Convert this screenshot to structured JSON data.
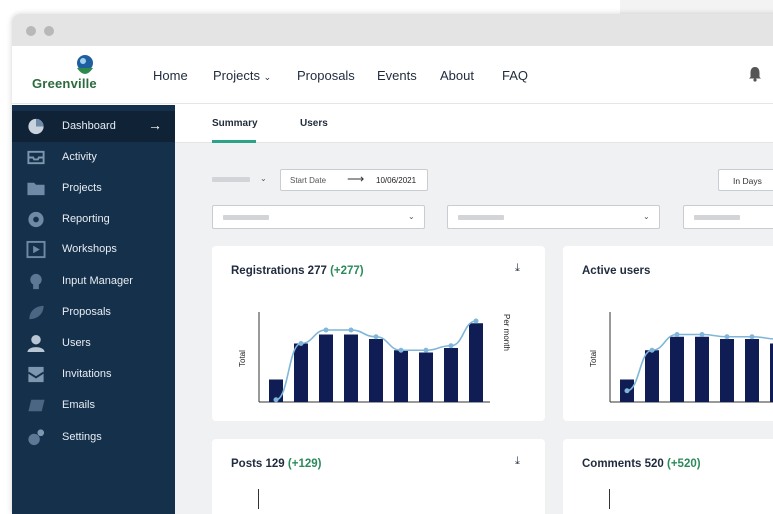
{
  "app": {
    "logo_text": "Greenville"
  },
  "nav": {
    "items": [
      "Home",
      "Projects",
      "Proposals",
      "Events",
      "About",
      "FAQ"
    ]
  },
  "sidebar": {
    "items": [
      {
        "label": "Dashboard",
        "icon": "pie-chart-icon",
        "active": true
      },
      {
        "label": "Activity",
        "icon": "inbox-icon"
      },
      {
        "label": "Projects",
        "icon": "folder-icon"
      },
      {
        "label": "Reporting",
        "icon": "report-icon"
      },
      {
        "label": "Workshops",
        "icon": "video-icon"
      },
      {
        "label": "Input Manager",
        "icon": "lightbulb-icon"
      },
      {
        "label": "Proposals",
        "icon": "leaf-icon"
      },
      {
        "label": "Users",
        "icon": "user-icon"
      },
      {
        "label": "Invitations",
        "icon": "invitation-icon"
      },
      {
        "label": "Emails",
        "icon": "email-icon"
      },
      {
        "label": "Settings",
        "icon": "gears-icon"
      }
    ]
  },
  "tabs": {
    "summary": "Summary",
    "users": "Users"
  },
  "filters": {
    "start_date_placeholder": "Start Date",
    "end_date": "10/06/2021",
    "unit": "In Days"
  },
  "cards": {
    "registrations": {
      "title": "Registrations 277",
      "delta": "(+277)"
    },
    "active_users": {
      "title": "Active users"
    },
    "posts": {
      "title": "Posts 129",
      "delta": "(+129)"
    },
    "comments": {
      "title": "Comments 520",
      "delta": "(+520)"
    }
  },
  "chart_data": [
    {
      "type": "bar",
      "title": "Registrations 277",
      "ylabel": "Total",
      "y2label": "Per month",
      "series": [
        {
          "values": [
            10,
            26,
            30,
            30,
            28,
            23,
            22,
            24,
            35
          ]
        }
      ],
      "line_overlay": [
        1,
        26,
        32,
        32,
        29,
        23,
        23,
        25,
        36
      ],
      "ylim": [
        0,
        40
      ],
      "colors": {
        "bar": "#0f1d54",
        "line": "#7fb6d9"
      }
    },
    {
      "type": "bar",
      "title": "Active users",
      "ylabel": "Total",
      "series": [
        {
          "values": [
            10,
            23,
            29,
            29,
            28,
            28,
            26
          ]
        }
      ],
      "line_overlay": [
        5,
        23,
        30,
        30,
        29,
        29,
        28
      ],
      "ylim": [
        0,
        40
      ],
      "colors": {
        "bar": "#0f1d54",
        "line": "#7fb6d9"
      }
    }
  ]
}
